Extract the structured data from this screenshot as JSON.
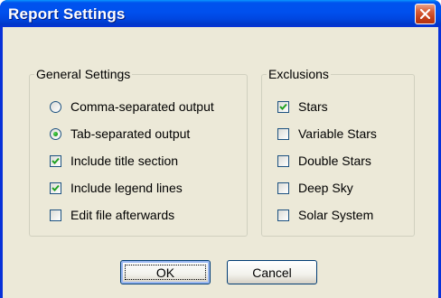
{
  "window": {
    "title": "Report Settings"
  },
  "general": {
    "title": "General Settings",
    "options": [
      {
        "label": "Comma-separated output",
        "type": "radio",
        "checked": false
      },
      {
        "label": "Tab-separated output",
        "type": "radio",
        "checked": true
      },
      {
        "label": "Include title section",
        "type": "checkbox",
        "checked": true
      },
      {
        "label": "Include legend lines",
        "type": "checkbox",
        "checked": true
      },
      {
        "label": "Edit file afterwards",
        "type": "checkbox",
        "checked": false
      }
    ]
  },
  "exclusions": {
    "title": "Exclusions",
    "items": [
      {
        "label": "Stars",
        "checked": true
      },
      {
        "label": "Variable Stars",
        "checked": false
      },
      {
        "label": "Double Stars",
        "checked": false
      },
      {
        "label": "Deep Sky",
        "checked": false
      },
      {
        "label": "Solar System",
        "checked": false
      }
    ]
  },
  "buttons": {
    "ok": "OK",
    "cancel": "Cancel"
  },
  "colors": {
    "titlebar": "#0054e3",
    "dialog_bg": "#ece9d8",
    "close_button": "#d9603a",
    "check_green": "#21a121"
  }
}
